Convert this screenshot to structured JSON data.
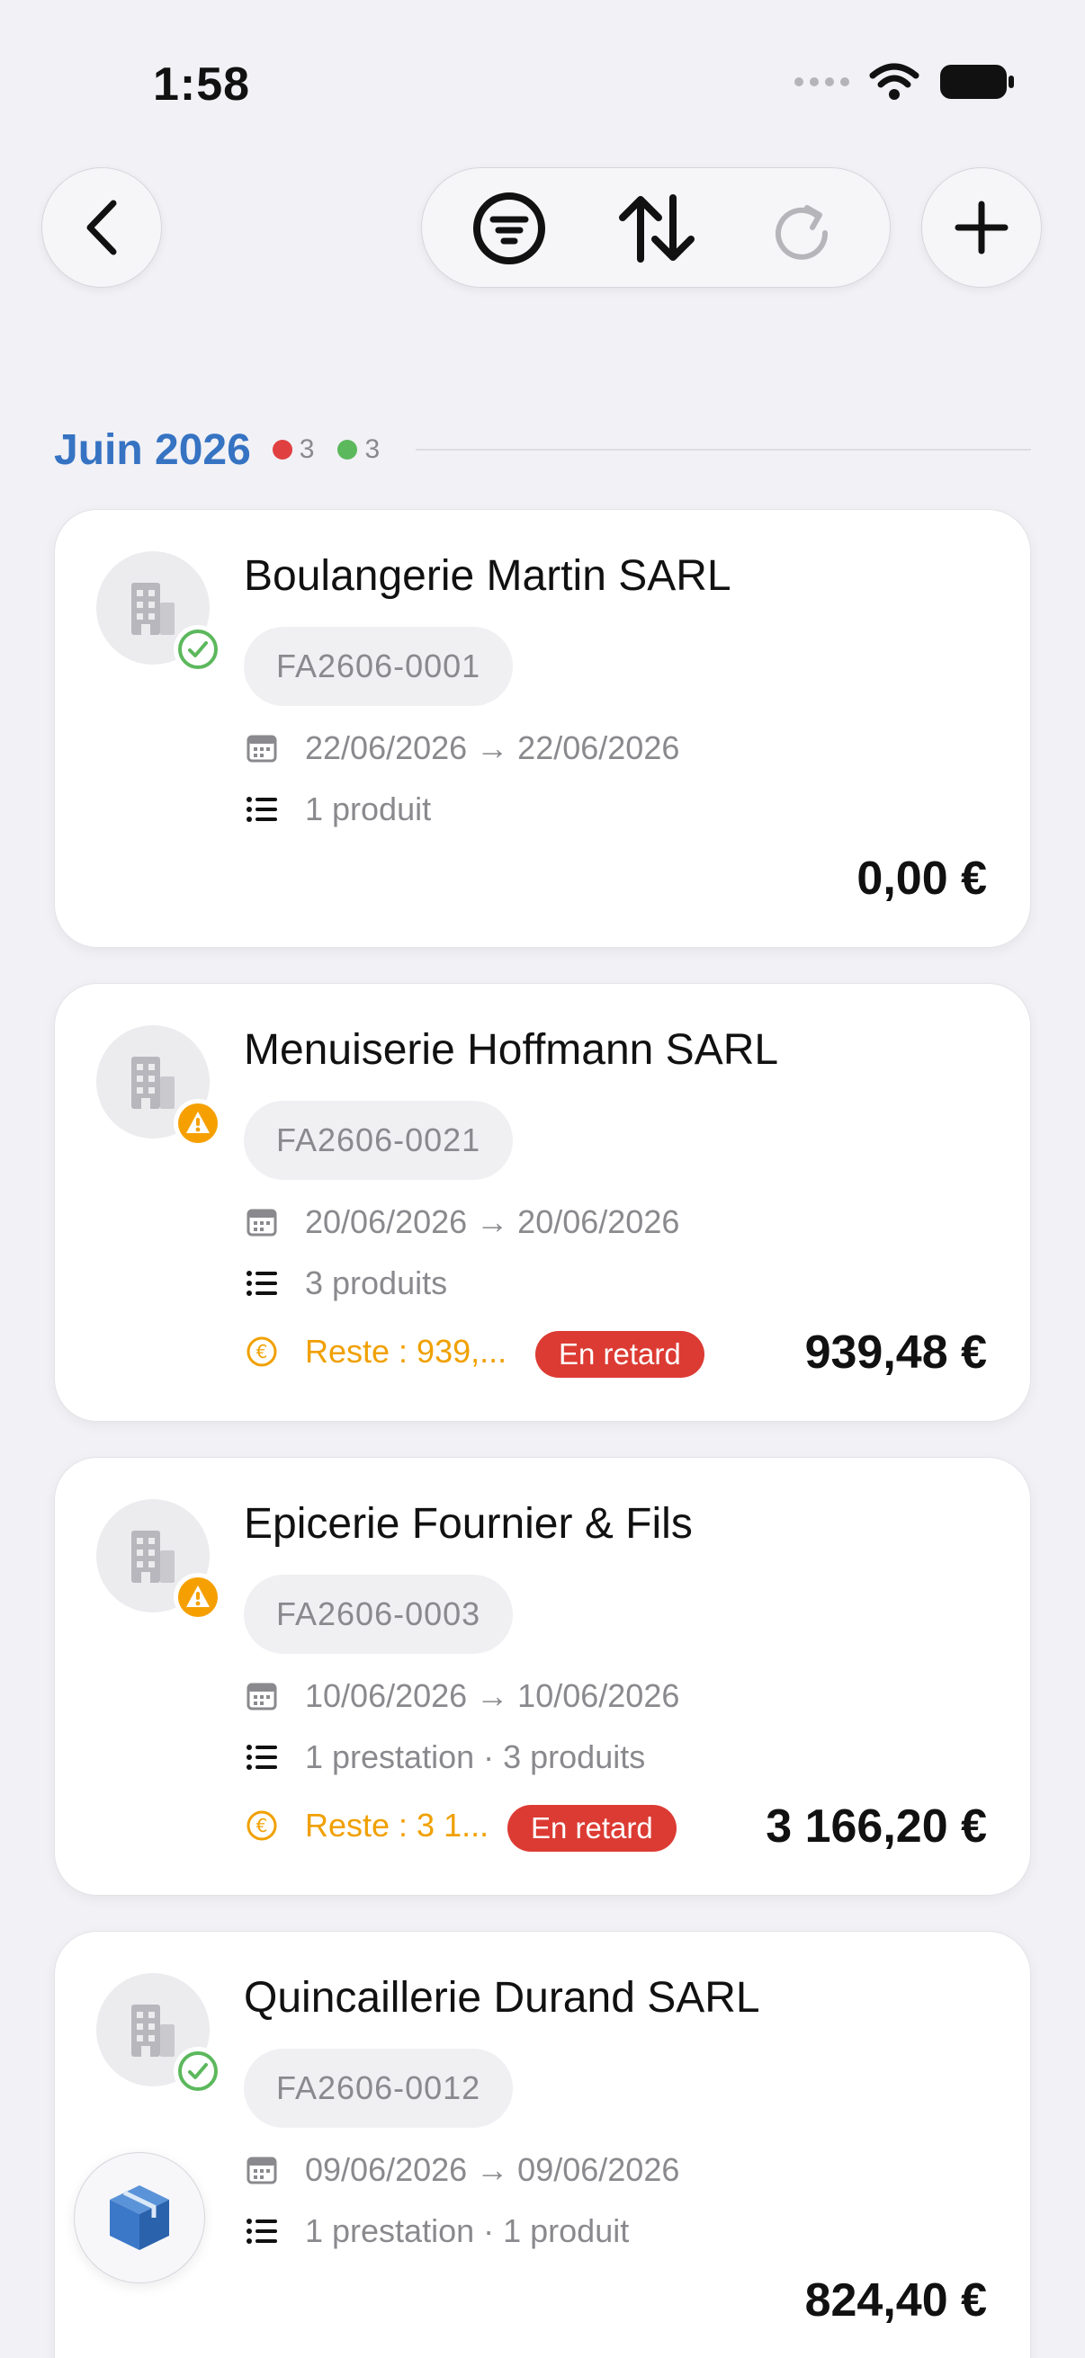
{
  "status_bar": {
    "time": "1:58"
  },
  "section": {
    "title": "Juin 2026",
    "badges": [
      {
        "count": "3",
        "color": "#e04040"
      },
      {
        "count": "3",
        "color": "#5cb85c"
      }
    ]
  },
  "invoices": [
    {
      "client": "Boulangerie Martin SARL",
      "ref": "FA2606-0001",
      "dates": "22/06/2026 → 22/06/2026",
      "items": "1 produit",
      "total": "0,00 €",
      "status": "paid"
    },
    {
      "client": "Menuiserie Hoffmann SARL",
      "ref": "FA2606-0021",
      "dates": "20/06/2026 → 20/06/2026",
      "items": "3 produits",
      "remaining": "Reste : 939,...",
      "late_label": "En retard",
      "total": "939,48 €",
      "status": "warning"
    },
    {
      "client": "Epicerie Fournier & Fils",
      "ref": "FA2606-0003",
      "dates": "10/06/2026 → 10/06/2026",
      "items": "1 prestation · 3 produits",
      "remaining": "Reste : 3 1...",
      "late_label": "En retard",
      "total": "3 166,20 €",
      "status": "warning"
    },
    {
      "client": "Quincaillerie Durand SARL",
      "ref": "FA2606-0012",
      "dates": "09/06/2026 → 09/06/2026",
      "items": "1 prestation · 1 produit",
      "total": "824,40 €",
      "status": "paid"
    }
  ],
  "icons": {
    "back": "chevron-left-icon",
    "filter": "filter-icon",
    "sort": "sort-arrows-icon",
    "refresh": "refresh-icon",
    "add": "plus-icon",
    "avatar": "building-icon",
    "paid": "check-circle-icon",
    "warning": "warning-icon",
    "calendar": "calendar-icon",
    "list": "list-icon",
    "euro": "euro-icon",
    "fab": "box-icon"
  },
  "colors": {
    "accent": "#3673c2",
    "paid": "#5cb85c",
    "warning": "#f5a000",
    "late": "#dc3b33",
    "fab": "#3b78c8"
  }
}
